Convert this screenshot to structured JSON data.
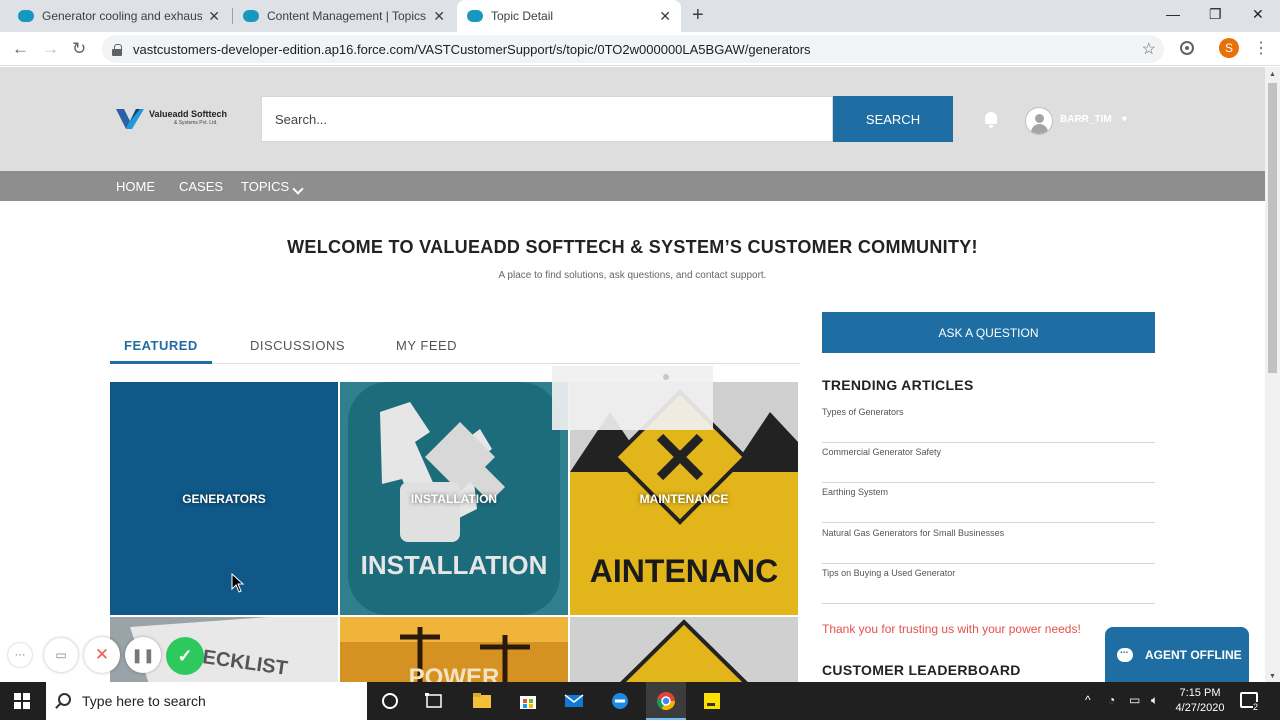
{
  "browser": {
    "tabs": [
      {
        "title": "Generator cooling and exhaust sy",
        "active": false
      },
      {
        "title": "Content Management | Topics | A",
        "active": false
      },
      {
        "title": "Topic Detail",
        "active": true
      }
    ],
    "url": "vastcustomers-developer-edition.ap16.force.com/VASTCustomerSupport/s/topic/0TO2w000000LA5BGAW/generators",
    "profile_initial": "S"
  },
  "header": {
    "logo_name": "Valueadd Softtech",
    "logo_sub": "& Systems Pvt. Ltd.",
    "search_placeholder": "Search...",
    "search_button": "SEARCH",
    "username": "BARR_TIM"
  },
  "nav": {
    "home": "HOME",
    "cases": "CASES",
    "topics": "TOPICS"
  },
  "hero": {
    "title": "WELCOME TO VALUEADD SOFTTECH & SYSTEM’S CUSTOMER COMMUNITY!",
    "tagline": "A place to find solutions, ask questions, and contact support."
  },
  "content_tabs": [
    "FEATURED",
    "DISCUSSIONS",
    "MY FEED"
  ],
  "tiles": [
    {
      "label": "GENERATORS",
      "image_text": ""
    },
    {
      "label": "INSTALLATION",
      "image_text": "INSTALLATION"
    },
    {
      "label": "MAINTENANCE",
      "image_text": "AINTENANC"
    },
    {
      "label": "",
      "image_text": "CHECKLIST"
    },
    {
      "label": "",
      "image_text": "POWER"
    },
    {
      "label": "",
      "image_text": ""
    }
  ],
  "sidebar": {
    "ask_button": "ASK A QUESTION",
    "trending_title": "TRENDING ARTICLES",
    "articles": [
      "Types of Generators",
      "Commercial Generator Safety",
      "Earthing System",
      "Natural Gas Generators for Small Businesses",
      "Tips on Buying a Used Generator"
    ],
    "thanks": "Thank you for trusting us with your power needs!",
    "leaderboard_title": "CUSTOMER LEADERBOARD"
  },
  "chat": {
    "label": "AGENT OFFLINE"
  },
  "taskbar": {
    "search_placeholder": "Type here to search",
    "time": "7:15 PM",
    "date": "4/27/2020",
    "notification_count": "2"
  },
  "colors": {
    "brand_blue": "#1f6ea3",
    "nav_gray": "#8e8e8e",
    "header_gray": "#dedede",
    "thanks_red": "#e8504a",
    "ok_green": "#2ec95c"
  }
}
